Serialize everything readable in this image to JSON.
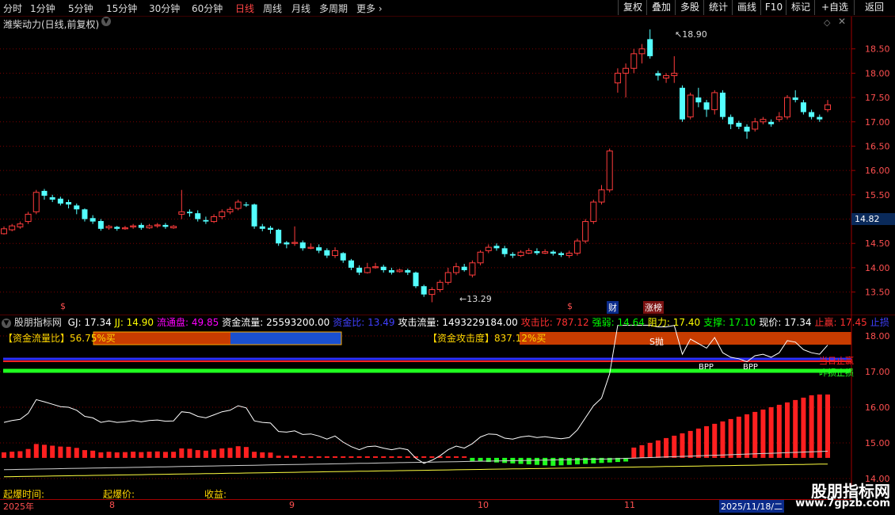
{
  "toolbar": {
    "periods": [
      "分时",
      "1分钟",
      "5分钟",
      "15分钟",
      "30分钟",
      "60分钟",
      "日线",
      "周线",
      "月线",
      "多周期"
    ],
    "active_period": "日线",
    "more_label": "更多 ›",
    "buttons": [
      "复权",
      "叠加",
      "多股",
      "统计",
      "画线",
      "F10",
      "标记",
      "+自选",
      "返回"
    ]
  },
  "main": {
    "title": "潍柴动力(日线,前复权)",
    "high_label": "18.90",
    "low_label": "13.29",
    "current_price_tag": "14.82",
    "price_ticks": [
      "18.50",
      "18.00",
      "17.50",
      "17.00",
      "16.50",
      "16.00",
      "15.50",
      "15.00",
      "14.50",
      "14.00",
      "13.50"
    ],
    "markers": {
      "cai": "财",
      "zhangbang": "涨榜",
      "dollar": "$"
    }
  },
  "sub": {
    "indicator_name": "股朋指标网",
    "readouts": [
      {
        "label": "GJ:",
        "value": "17.34",
        "color": "#ffffff"
      },
      {
        "label": "JJ:",
        "value": "14.90",
        "color": "#ffff00"
      },
      {
        "label": "流通盘:",
        "value": "49.85",
        "color": "#ff00ff"
      },
      {
        "label": "资金流量:",
        "value": "25593200.00",
        "color": "#ffffff"
      },
      {
        "label": "资金比:",
        "value": "13.49",
        "color": "#4040ff"
      },
      {
        "label": "攻击流量:",
        "value": "1493229184.00",
        "color": "#ffffff"
      },
      {
        "label": "攻击比:",
        "value": "787.12",
        "color": "#ff3030"
      },
      {
        "label": "强弱:",
        "value": "14.64",
        "color": "#00ff00"
      },
      {
        "label": "阻力:",
        "value": "17.40",
        "color": "#ffff00"
      },
      {
        "label": "支撑:",
        "value": "17.10",
        "color": "#00ff00"
      },
      {
        "label": "现价:",
        "value": "17.34",
        "color": "#ffffff"
      },
      {
        "label": "止赢:",
        "value": "17.45",
        "color": "#ff3030"
      },
      {
        "label": "止损",
        "value": "",
        "color": "#4040ff"
      }
    ],
    "fund_ratio_label": "【资金流量比】56.75%买",
    "attack_label": "【资金攻击度】837.12%买",
    "buy_signal": "S抛",
    "stop_profit": "当日止赢",
    "stop_loss": "昨损止损",
    "bpp": "BPP",
    "price_ticks": [
      "18.00",
      "17.00",
      "16.00",
      "15.00",
      "14.00"
    ]
  },
  "bottom": {
    "explode_time": "起爆时间:",
    "explode_price": "起爆价:",
    "profit": "收益:",
    "year": "2025年",
    "months": [
      "8",
      "9",
      "10",
      "11"
    ],
    "date_box": "2025/11/18/二",
    "watermark_cn": "股朋指标网",
    "watermark_url": "www.7gpzb.com"
  },
  "colors": {
    "up": "#ff3c3c",
    "down": "#54ffff",
    "grid": "#7a0000",
    "axis": "#a00000"
  },
  "chart_data": {
    "type": "candlestick",
    "series": [
      {
        "name": "潍柴动力(日线,前复权)",
        "ohlc": [
          [
            14.7,
            14.8,
            14.68,
            14.85
          ],
          [
            14.78,
            14.86,
            14.75,
            14.9
          ],
          [
            14.84,
            14.9,
            14.8,
            14.95
          ],
          [
            14.95,
            15.1,
            14.9,
            15.15
          ],
          [
            15.15,
            15.55,
            15.1,
            15.6
          ],
          [
            15.58,
            15.48,
            15.4,
            15.62
          ],
          [
            15.45,
            15.4,
            15.35,
            15.5
          ],
          [
            15.42,
            15.32,
            15.28,
            15.46
          ],
          [
            15.35,
            15.3,
            15.22,
            15.4
          ],
          [
            15.28,
            15.2,
            15.1,
            15.32
          ],
          [
            15.2,
            15.0,
            14.95,
            15.22
          ],
          [
            15.02,
            14.95,
            14.9,
            15.08
          ],
          [
            14.96,
            14.8,
            14.76,
            15.0
          ],
          [
            14.82,
            14.85,
            14.78,
            14.88
          ],
          [
            14.84,
            14.8,
            14.76,
            14.86
          ],
          [
            14.8,
            14.82,
            14.78,
            14.86
          ],
          [
            14.84,
            14.86,
            14.8,
            14.9
          ],
          [
            14.88,
            14.82,
            14.78,
            14.92
          ],
          [
            14.82,
            14.86,
            14.8,
            14.9
          ],
          [
            14.86,
            14.88,
            14.82,
            14.92
          ],
          [
            14.88,
            14.84,
            14.8,
            14.92
          ],
          [
            14.82,
            14.85,
            14.8,
            14.88
          ],
          [
            15.1,
            15.15,
            15.0,
            15.6
          ],
          [
            15.15,
            15.12,
            15.05,
            15.2
          ],
          [
            15.12,
            15.0,
            14.95,
            15.18
          ],
          [
            14.98,
            14.95,
            14.9,
            15.05
          ],
          [
            14.95,
            15.05,
            14.92,
            15.1
          ],
          [
            15.05,
            15.15,
            15.0,
            15.2
          ],
          [
            15.15,
            15.2,
            15.1,
            15.25
          ],
          [
            15.22,
            15.35,
            15.18,
            15.4
          ],
          [
            15.3,
            15.28,
            15.25,
            15.35
          ],
          [
            15.3,
            14.85,
            14.8,
            15.32
          ],
          [
            14.85,
            14.8,
            14.75,
            14.9
          ],
          [
            14.82,
            14.78,
            14.7,
            14.86
          ],
          [
            14.78,
            14.5,
            14.45,
            14.8
          ],
          [
            14.52,
            14.48,
            14.4,
            14.55
          ],
          [
            14.5,
            14.52,
            14.45,
            14.85
          ],
          [
            14.52,
            14.4,
            14.35,
            14.56
          ],
          [
            14.4,
            14.42,
            14.38,
            14.5
          ],
          [
            14.42,
            14.35,
            14.3,
            14.48
          ],
          [
            14.36,
            14.25,
            14.2,
            14.4
          ],
          [
            14.25,
            14.35,
            14.2,
            14.42
          ],
          [
            14.3,
            14.15,
            14.1,
            14.32
          ],
          [
            14.15,
            14.0,
            13.95,
            14.18
          ],
          [
            14.0,
            13.9,
            13.85,
            14.05
          ],
          [
            13.9,
            14.0,
            13.88,
            14.1
          ],
          [
            14.0,
            14.02,
            13.98,
            14.1
          ],
          [
            14.02,
            13.95,
            13.9,
            14.06
          ],
          [
            13.95,
            13.9,
            13.86,
            14.0
          ],
          [
            13.92,
            13.95,
            13.9,
            13.98
          ],
          [
            13.95,
            13.9,
            13.85,
            13.98
          ],
          [
            13.9,
            13.62,
            13.58,
            13.92
          ],
          [
            13.62,
            13.45,
            13.4,
            13.65
          ],
          [
            13.45,
            13.55,
            13.29,
            13.6
          ],
          [
            13.55,
            13.7,
            13.5,
            13.75
          ],
          [
            13.7,
            13.9,
            13.65,
            14.0
          ],
          [
            13.9,
            14.02,
            13.85,
            14.1
          ],
          [
            14.02,
            13.95,
            13.92,
            14.08
          ],
          [
            13.85,
            14.1,
            13.8,
            14.15
          ],
          [
            14.1,
            14.32,
            14.05,
            14.36
          ],
          [
            14.35,
            14.42,
            14.3,
            14.48
          ],
          [
            14.45,
            14.4,
            14.35,
            14.5
          ],
          [
            14.4,
            14.28,
            14.22,
            14.45
          ],
          [
            14.28,
            14.25,
            14.2,
            14.32
          ],
          [
            14.25,
            14.32,
            14.22,
            14.36
          ],
          [
            14.3,
            14.35,
            14.28,
            14.4
          ],
          [
            14.34,
            14.3,
            14.26,
            14.4
          ],
          [
            14.3,
            14.33,
            14.28,
            14.38
          ],
          [
            14.33,
            14.29,
            14.25,
            14.36
          ],
          [
            14.3,
            14.26,
            14.22,
            14.33
          ],
          [
            14.25,
            14.3,
            14.2,
            14.35
          ],
          [
            14.3,
            14.55,
            14.25,
            14.6
          ],
          [
            14.55,
            14.95,
            14.5,
            15.0
          ],
          [
            14.95,
            15.35,
            14.9,
            15.4
          ],
          [
            15.35,
            15.6,
            15.3,
            15.7
          ],
          [
            15.6,
            16.4,
            15.55,
            16.45
          ],
          [
            17.8,
            18.0,
            17.6,
            18.1
          ],
          [
            18.0,
            18.1,
            17.5,
            18.2
          ],
          [
            18.1,
            18.4,
            18.0,
            18.5
          ],
          [
            18.4,
            18.5,
            18.2,
            18.6
          ],
          [
            18.7,
            18.35,
            18.3,
            18.9
          ],
          [
            18.0,
            17.95,
            17.85,
            18.05
          ],
          [
            17.9,
            17.95,
            17.8,
            18.0
          ],
          [
            17.95,
            18.0,
            17.8,
            18.35
          ],
          [
            17.7,
            17.05,
            17.0,
            17.75
          ],
          [
            17.1,
            17.55,
            17.05,
            17.6
          ],
          [
            17.5,
            17.4,
            17.3,
            17.7
          ],
          [
            17.4,
            17.25,
            17.1,
            17.45
          ],
          [
            17.25,
            17.6,
            17.15,
            17.65
          ],
          [
            17.6,
            17.1,
            17.05,
            17.65
          ],
          [
            17.1,
            16.95,
            16.85,
            17.15
          ],
          [
            16.98,
            16.9,
            16.85,
            17.02
          ],
          [
            16.9,
            16.8,
            16.65,
            16.95
          ],
          [
            16.85,
            17.0,
            16.8,
            17.08
          ],
          [
            17.0,
            17.05,
            16.95,
            17.1
          ],
          [
            17.0,
            16.95,
            16.9,
            17.05
          ],
          [
            17.05,
            17.1,
            17.0,
            17.2
          ],
          [
            17.1,
            17.5,
            17.05,
            17.55
          ],
          [
            17.5,
            17.45,
            17.4,
            17.65
          ],
          [
            17.4,
            17.2,
            17.15,
            17.45
          ],
          [
            17.2,
            17.1,
            17.05,
            17.25
          ],
          [
            17.1,
            17.05,
            17.0,
            17.15
          ],
          [
            17.25,
            17.35,
            17.2,
            17.45
          ]
        ]
      }
    ],
    "y_range": [
      13.2,
      19.0
    ]
  }
}
